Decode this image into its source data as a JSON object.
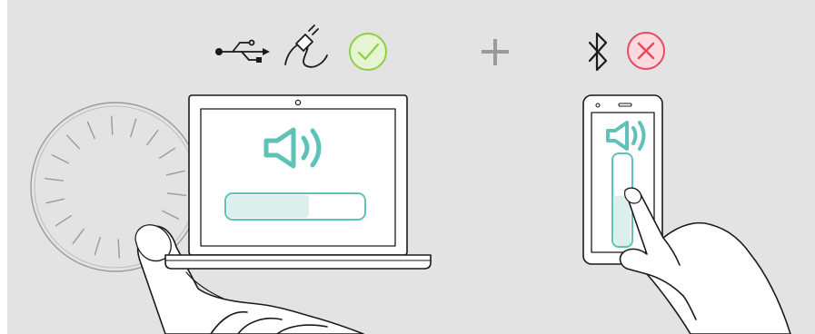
{
  "illustration": {
    "background_color": "#e3e3e4",
    "accent_color": "#5fc2b8",
    "check_color": "#8fcf45",
    "check_fill": "#e6f4d3",
    "cross_color": "#e84a5f",
    "cross_fill": "#fbd9dd",
    "line_color": "#1a1a1a",
    "usb_connection": {
      "icon": "usb-icon",
      "status": "connected",
      "status_icon": "check-icon"
    },
    "wired_connection": {
      "icon": "cable-plug-icon"
    },
    "combine_icon": "plus-icon",
    "bluetooth_connection": {
      "icon": "bluetooth-icon",
      "status": "not-controlled",
      "status_icon": "cross-icon"
    },
    "laptop_volume": {
      "icon": "speaker-volume-icon",
      "level": 0.6
    },
    "phone_volume": {
      "icon": "speaker-volume-icon",
      "level": 0.56
    },
    "dial": {
      "name": "volume-dial",
      "tick_count": 18
    }
  }
}
